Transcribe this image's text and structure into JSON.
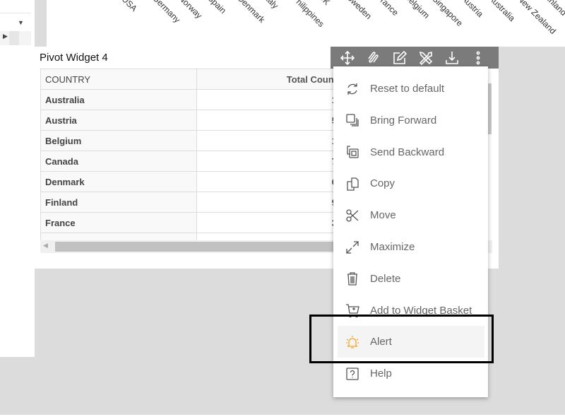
{
  "chart": {
    "x_tick_labels": [
      "USA",
      "Germany",
      "Norway",
      "Spain",
      "Denmark",
      "Italy",
      "Philippines",
      "UK",
      "Sweden",
      "France",
      "Belgium",
      "Singapore",
      "Austria",
      "Australia",
      "New Zealand",
      "Finland"
    ]
  },
  "widget": {
    "title": "Pivot Widget 4",
    "columns": [
      "COUNTRY",
      "Total Count"
    ],
    "rows": [
      {
        "country": "Australia",
        "count": "1"
      },
      {
        "country": "Austria",
        "count": "5"
      },
      {
        "country": "Belgium",
        "count": "1"
      },
      {
        "country": "Canada",
        "count": "7"
      },
      {
        "country": "Denmark",
        "count": "6"
      },
      {
        "country": "Finland",
        "count": "9"
      },
      {
        "country": "France",
        "count": "3"
      },
      {
        "country": "G",
        "count": ""
      }
    ]
  },
  "toolbar": {
    "icons": [
      "move-arrows-icon",
      "drill-icon",
      "edit-icon",
      "tools-icon",
      "download-icon",
      "more-vertical-icon"
    ]
  },
  "menu": {
    "items": [
      {
        "label": "Reset to default",
        "icon": "refresh-icon"
      },
      {
        "label": "Bring Forward",
        "icon": "bring-forward-icon"
      },
      {
        "label": "Send Backward",
        "icon": "send-backward-icon"
      },
      {
        "label": "Copy",
        "icon": "copy-icon"
      },
      {
        "label": "Move",
        "icon": "scissors-icon"
      },
      {
        "label": "Maximize",
        "icon": "maximize-icon"
      },
      {
        "label": "Delete",
        "icon": "trash-icon"
      },
      {
        "label": "Add to Widget Basket",
        "icon": "cart-icon"
      },
      {
        "label": "Alert",
        "icon": "bell-icon",
        "active": true
      },
      {
        "label": "Help",
        "icon": "help-icon"
      }
    ],
    "accent_color": "#f5a623"
  }
}
